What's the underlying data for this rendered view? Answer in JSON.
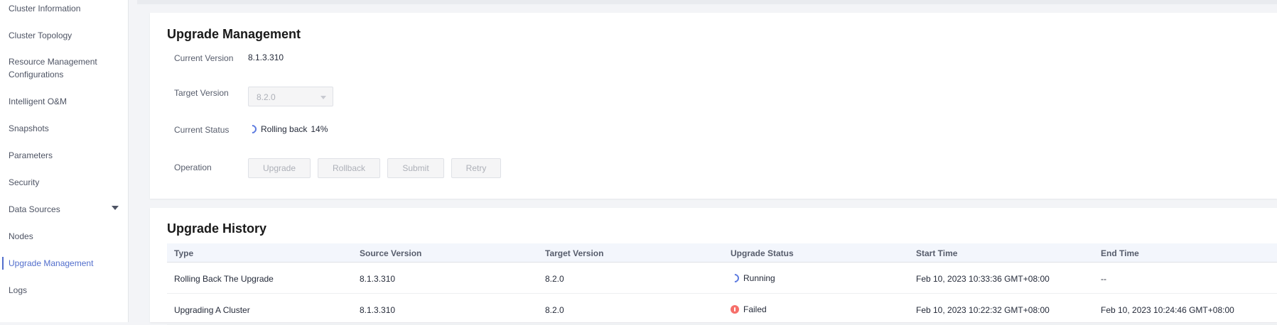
{
  "sidebar": {
    "items": [
      {
        "label": "Cluster Information"
      },
      {
        "label": "Cluster Topology"
      },
      {
        "label": "Resource Management Configurations"
      },
      {
        "label": "Intelligent O&M"
      },
      {
        "label": "Snapshots"
      },
      {
        "label": "Parameters"
      },
      {
        "label": "Security"
      },
      {
        "label": "Data Sources"
      },
      {
        "label": "Nodes"
      },
      {
        "label": "Upgrade Management"
      },
      {
        "label": "Logs"
      }
    ],
    "active": "Upgrade Management"
  },
  "upgrade": {
    "title": "Upgrade Management",
    "current_version_label": "Current Version",
    "current_version": "8.1.3.310",
    "target_version_label": "Target Version",
    "target_version": "8.2.0",
    "status_label": "Current Status",
    "status_text": "Rolling back",
    "status_progress": "14%",
    "operation_label": "Operation",
    "buttons": {
      "upgrade": "Upgrade",
      "rollback": "Rollback",
      "submit": "Submit",
      "retry": "Retry"
    }
  },
  "history": {
    "title": "Upgrade History",
    "columns": [
      "Type",
      "Source Version",
      "Target Version",
      "Upgrade Status",
      "Start Time",
      "End Time"
    ],
    "rows": [
      {
        "type": "Rolling Back The Upgrade",
        "source": "8.1.3.310",
        "target": "8.2.0",
        "status": "Running",
        "start": "Feb 10, 2023 10:33:36 GMT+08:00",
        "end": "--"
      },
      {
        "type": "Upgrading A Cluster",
        "source": "8.1.3.310",
        "target": "8.2.0",
        "status": "Failed",
        "start": "Feb 10, 2023 10:22:32 GMT+08:00",
        "end": "Feb 10, 2023 10:24:46 GMT+08:00"
      }
    ]
  },
  "colors": {
    "accent": "#526ecc",
    "failed": "#f66f6a",
    "running": "#5e7ce0"
  }
}
